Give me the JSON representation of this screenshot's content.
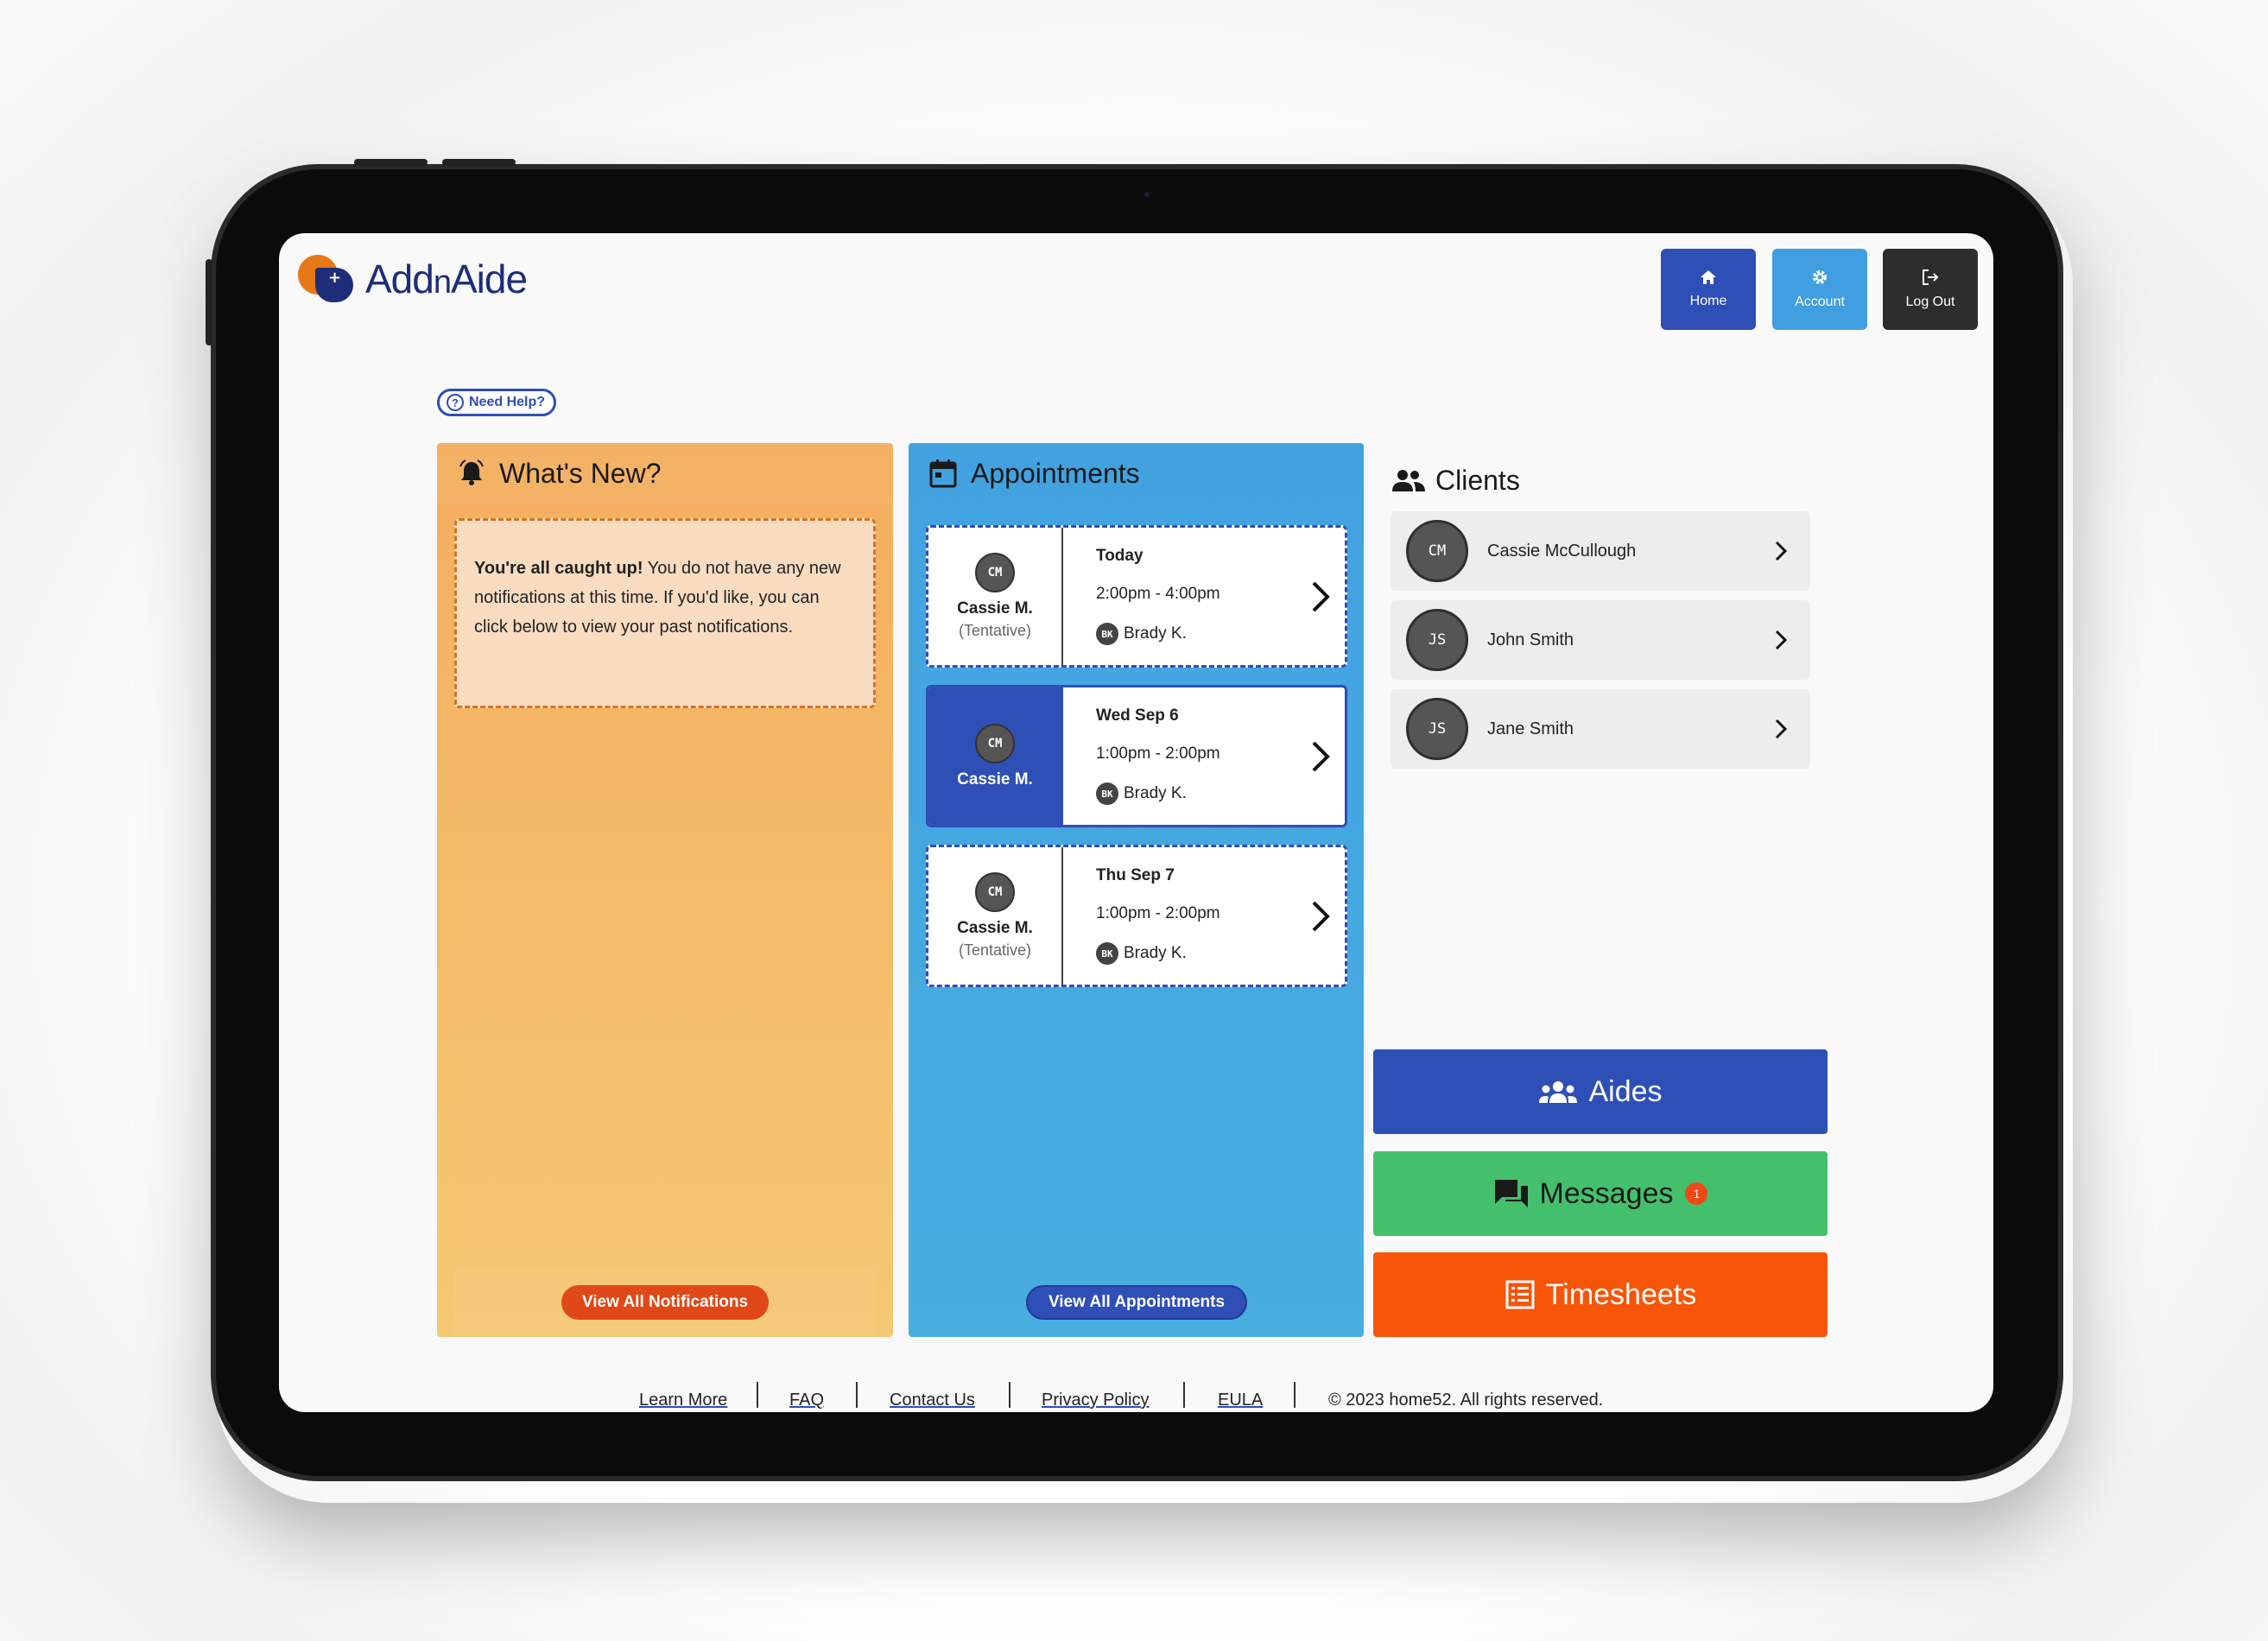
{
  "brand": {
    "name_add": "Add",
    "name_n": "n",
    "name_aide": "Aide"
  },
  "nav": {
    "home": "Home",
    "account": "Account",
    "logout": "Log Out"
  },
  "help": {
    "label": "Need Help?"
  },
  "whats_new": {
    "title": "What's New?",
    "notice_bold": "You're all caught up!",
    "notice_text": " You do not have any new notifications at this time. If you'd like, you can click below to view your past notifications.",
    "button": "View All Notifications"
  },
  "appointments": {
    "title": "Appointments",
    "items": [
      {
        "initials": "CM",
        "client": "Cassie M.",
        "status": "(Tentative)",
        "date": "Today",
        "time": "2:00pm - 4:00pm",
        "aide_initials": "BK",
        "aide": "Brady K."
      },
      {
        "initials": "CM",
        "client": "Cassie M.",
        "status": "",
        "date": "Wed Sep 6",
        "time": "1:00pm - 2:00pm",
        "aide_initials": "BK",
        "aide": "Brady K."
      },
      {
        "initials": "CM",
        "client": "Cassie M.",
        "status": "(Tentative)",
        "date": "Thu Sep 7",
        "time": "1:00pm - 2:00pm",
        "aide_initials": "BK",
        "aide": "Brady K."
      }
    ],
    "button": "View All Appointments"
  },
  "clients": {
    "title": "Clients",
    "items": [
      {
        "initials": "CM",
        "name": "Cassie McCullough"
      },
      {
        "initials": "JS",
        "name": "John Smith"
      },
      {
        "initials": "JS",
        "name": "Jane Smith"
      }
    ]
  },
  "actions": {
    "aides": "Aides",
    "messages": "Messages",
    "messages_badge": "1",
    "timesheets": "Timesheets"
  },
  "footer": {
    "learn_more": "Learn More",
    "faq": "FAQ",
    "contact": "Contact Us",
    "privacy": "Privacy Policy",
    "eula": "EULA",
    "copyright": "© 2023 home52. All rights reserved."
  },
  "colors": {
    "primary": "#2e4fb6",
    "accent_blue": "#419ee0",
    "orange": "#f4ae5f",
    "green": "#44c06c",
    "red_orange": "#f75508"
  }
}
